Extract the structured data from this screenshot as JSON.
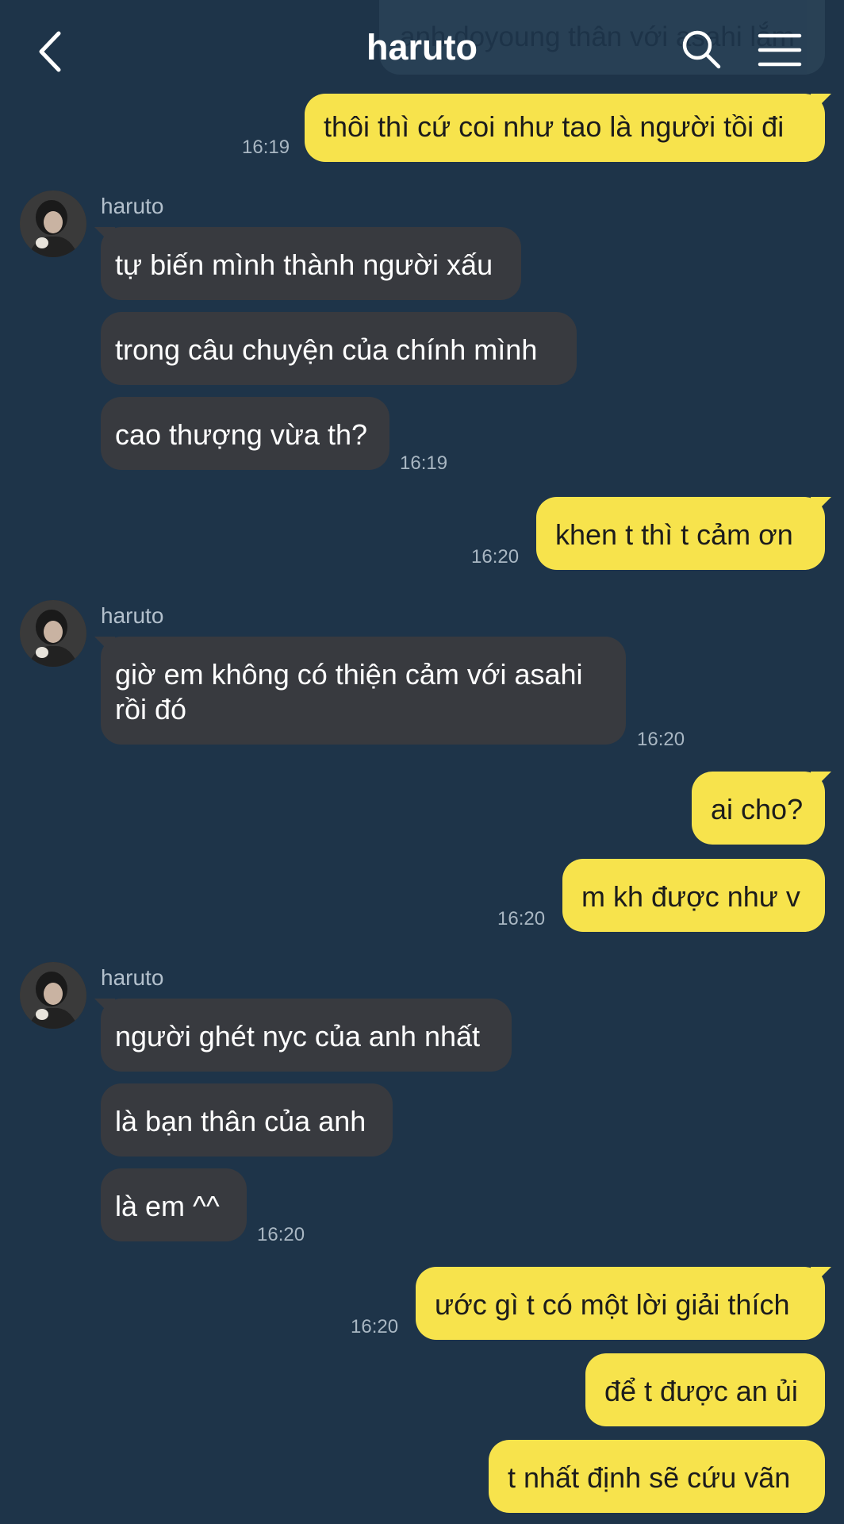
{
  "header": {
    "title": "haruto",
    "ghost_text": "anh doyoung thân với asahi lắm",
    "back_icon": "chevron-left-icon",
    "search_icon": "search-icon",
    "menu_icon": "hamburger-menu-icon"
  },
  "colors": {
    "background": "#1e3449",
    "outgoing_bubble": "#f7e34c",
    "incoming_bubble": "#383a3f"
  },
  "messages": {
    "m1": {
      "text": "thôi thì cứ coi như tao là người tồi đi",
      "time": "16:19"
    },
    "g1": {
      "sender": "haruto",
      "b1": "tự biến mình thành người xấu",
      "b2": "trong câu chuyện của chính mình",
      "b3": "cao thượng vừa th?",
      "time": "16:19"
    },
    "m2": {
      "text": "khen t thì t cảm ơn",
      "time": "16:20"
    },
    "g2": {
      "sender": "haruto",
      "b1_line1": "giờ em không có thiện cảm với asahi",
      "b1_line2": "rồi đó",
      "time": "16:20"
    },
    "m3": {
      "b1": "ai cho?",
      "b2": "m kh được như v",
      "time": "16:20"
    },
    "g3": {
      "sender": "haruto",
      "b1": "người ghét nyc của anh nhất",
      "b2": "là bạn thân của anh",
      "b3": "là em ^^",
      "time": "16:20"
    },
    "m4": {
      "b1": "ước gì t có một lời giải thích",
      "b2": "để t được an ủi",
      "b3": "t nhất định sẽ cứu vãn",
      "time": "16:20"
    }
  }
}
